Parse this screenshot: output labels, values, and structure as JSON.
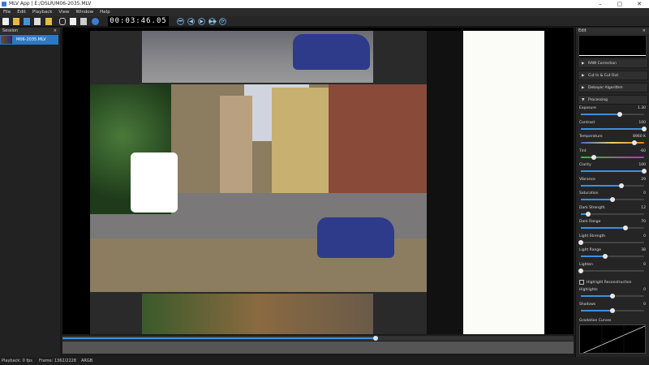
{
  "titlebar": {
    "title": "MLV App | E:/DSLR/M06-2035.MLV",
    "minimize": "–",
    "maximize": "▢",
    "close": "✕"
  },
  "menu": [
    "File",
    "Edit",
    "Playback",
    "View",
    "Window",
    "Help"
  ],
  "timecode": "00:03:46.05",
  "playback_buttons": [
    "⏮",
    "◀",
    "▶",
    "▶▶",
    "⟳"
  ],
  "session": {
    "title": "Session",
    "close": "×",
    "selected_clip": "M06-2035.MLV"
  },
  "edit_panel": {
    "title": "Edit",
    "close": "×",
    "sections": {
      "raw_correction": "RAW Correction",
      "cut_in_out": "Cut In & Cut Out",
      "debayer": "Debayer Algorithm",
      "processing": "Processing"
    },
    "params": [
      {
        "label": "Exposure",
        "value": "1.30",
        "level": 0.62
      },
      {
        "label": "Contrast",
        "value": "100",
        "level": 1.0
      },
      {
        "label": "Temperature",
        "value": "8960 K",
        "level": 0.85,
        "kind": "temp"
      },
      {
        "label": "Tint",
        "value": "-60",
        "level": 0.2,
        "kind": "tint"
      },
      {
        "label": "Clarity",
        "value": "100",
        "level": 1.0
      },
      {
        "label": "Vibrance",
        "value": "29",
        "level": 0.64
      },
      {
        "label": "Saturation",
        "value": "0",
        "level": 0.5
      },
      {
        "label": "Dark Strength",
        "value": "12",
        "level": 0.12
      },
      {
        "label": "Dark Range",
        "value": "70",
        "level": 0.7
      },
      {
        "label": "Light Strength",
        "value": "0",
        "level": 0.0
      },
      {
        "label": "Light Range",
        "value": "38",
        "level": 0.38
      },
      {
        "label": "Lighten",
        "value": "0",
        "level": 0.0
      }
    ],
    "highlight_reconstruction": "Highlight Reconstruction",
    "params2": [
      {
        "label": "Highlights",
        "value": "0",
        "level": 0.5
      },
      {
        "label": "Shadows",
        "value": "0",
        "level": 0.5
      }
    ],
    "gradation": "Gradation Curves"
  },
  "seek": {
    "progress": 0.612
  },
  "status": {
    "playback": "Playback: 0 fps",
    "frame": "Frame: 1362/2228",
    "mode": "ARGB"
  },
  "colors": {
    "accent": "#3d8fe0",
    "selection": "#2a78c8"
  }
}
